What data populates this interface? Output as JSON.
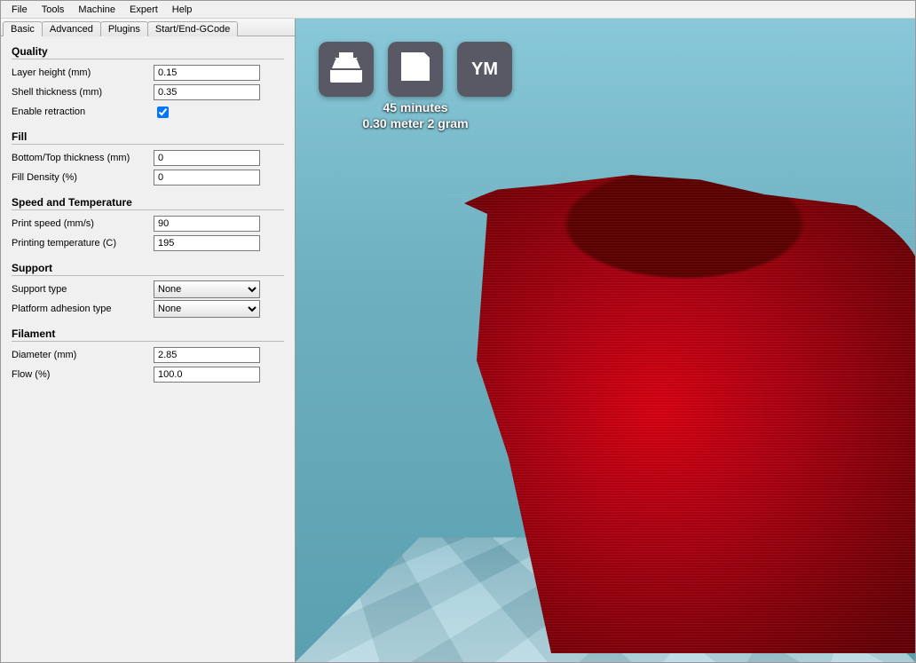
{
  "menu": {
    "file": "File",
    "tools": "Tools",
    "machine": "Machine",
    "expert": "Expert",
    "help": "Help"
  },
  "tabs": {
    "basic": "Basic",
    "advanced": "Advanced",
    "plugins": "Plugins",
    "gcode": "Start/End-GCode"
  },
  "sections": {
    "quality": "Quality",
    "fill": "Fill",
    "speed": "Speed and Temperature",
    "support": "Support",
    "filament": "Filament"
  },
  "labels": {
    "layer_height": "Layer height (mm)",
    "shell_thickness": "Shell thickness (mm)",
    "enable_retraction": "Enable retraction",
    "bottom_top_thickness": "Bottom/Top thickness (mm)",
    "fill_density": "Fill Density (%)",
    "print_speed": "Print speed (mm/s)",
    "printing_temp": "Printing temperature (C)",
    "support_type": "Support type",
    "platform_adhesion": "Platform adhesion type",
    "diameter": "Diameter (mm)",
    "flow": "Flow (%)"
  },
  "values": {
    "layer_height": "0.15",
    "shell_thickness": "0.35",
    "enable_retraction": true,
    "bottom_top_thickness": "0",
    "fill_density": "0",
    "print_speed": "90",
    "printing_temp": "195",
    "support_type": "None",
    "platform_adhesion": "None",
    "diameter": "2.85",
    "flow": "100.0"
  },
  "toolbar": {
    "ym": "YM"
  },
  "stats": {
    "time": "45 minutes",
    "material": "0.30 meter 2 gram"
  }
}
